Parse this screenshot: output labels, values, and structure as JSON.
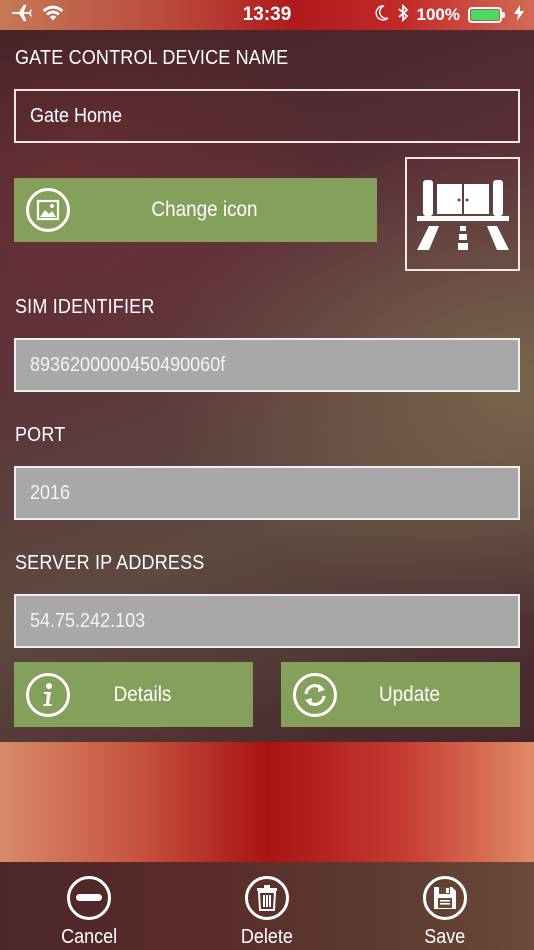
{
  "status_bar": {
    "time": "13:39",
    "battery_percent": "100%",
    "icons": [
      "airplane-icon",
      "wifi-icon",
      "moon-icon",
      "bluetooth-icon",
      "battery-icon",
      "charging-icon"
    ]
  },
  "form": {
    "device_name_label": "GATE CONTROL DEVICE NAME",
    "device_name_value": "Gate Home",
    "change_icon_label": "Change icon",
    "sim_label": "SIM IDENTIFIER",
    "sim_value": "8936200000450490060f",
    "port_label": "PORT",
    "port_value": "2016",
    "server_label": "SERVER IP ADDRESS",
    "server_value": "54.75.242.103",
    "details_label": "Details",
    "update_label": "Update"
  },
  "tabbar": {
    "cancel_label": "Cancel",
    "delete_label": "Delete",
    "save_label": "Save"
  },
  "colors": {
    "button_green": "#85a05a",
    "field_grey": "#a8a8a8",
    "accent_red": "#b01a1a",
    "battery_green": "#4cd964"
  }
}
